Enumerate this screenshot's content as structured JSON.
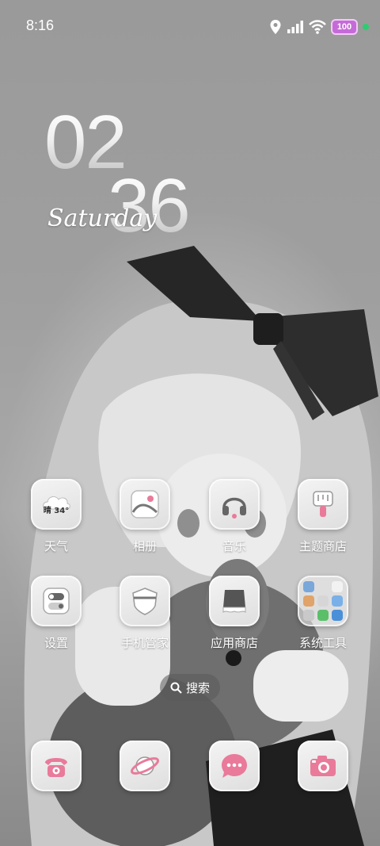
{
  "status_bar": {
    "time": "8:16",
    "battery": "100"
  },
  "clock": {
    "hours": "02",
    "minutes": "36",
    "day": "Saturday"
  },
  "weather": {
    "badge": "晴 34°"
  },
  "apps": {
    "row1": [
      "天气",
      "相册",
      "音乐",
      "主题商店"
    ],
    "row2": [
      "设置",
      "手机管家",
      "应用商店",
      "系统工具"
    ]
  },
  "search": {
    "label": "搜索"
  },
  "dock": [
    "phone-icon",
    "browser-icon",
    "messages-icon",
    "camera-icon"
  ],
  "colors": {
    "accent": "#e97a9a",
    "battery": "#c56bd8",
    "signal_dot": "#2ecc71"
  }
}
